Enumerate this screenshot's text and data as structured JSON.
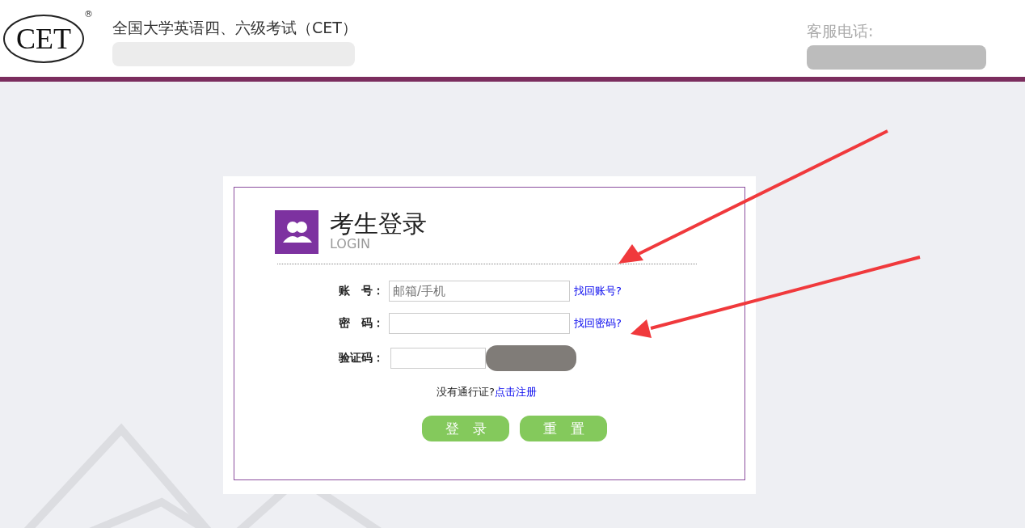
{
  "header": {
    "logo": {
      "text": "CET",
      "mark": "®"
    },
    "title": "全国大学英语四、六级考试（CET）",
    "phone_label": "客服电话:"
  },
  "login": {
    "title": "考生登录",
    "subtitle": "LOGIN",
    "fields": [
      {
        "kind": "text",
        "label": "账　号：",
        "placeholder": "邮箱/手机",
        "link": "找回账号?"
      },
      {
        "kind": "password",
        "label": "密　码：",
        "link": "找回密码?"
      },
      {
        "kind": "captcha",
        "label": "验证码："
      }
    ],
    "register": {
      "prompt": "没有通行证?",
      "link": "点击注册"
    },
    "buttons": [
      "登　录",
      "重　置"
    ]
  }
}
